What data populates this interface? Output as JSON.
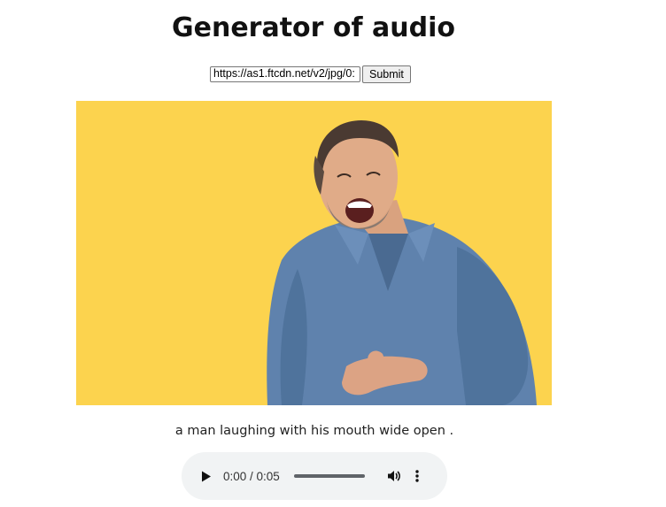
{
  "page": {
    "title": "Generator of audio"
  },
  "form": {
    "url_value": "https://as1.ftcdn.net/v2/jpg/0:",
    "submit_label": "Submit"
  },
  "result": {
    "image_alt": "man laughing photo",
    "background_color": "#fcd34e",
    "caption": "a man laughing with his mouth wide open ."
  },
  "audio_player": {
    "time_display": "0:00 / 0:05",
    "progress": 0,
    "icons": [
      "play-icon",
      "volume-icon",
      "more-options-icon"
    ]
  }
}
